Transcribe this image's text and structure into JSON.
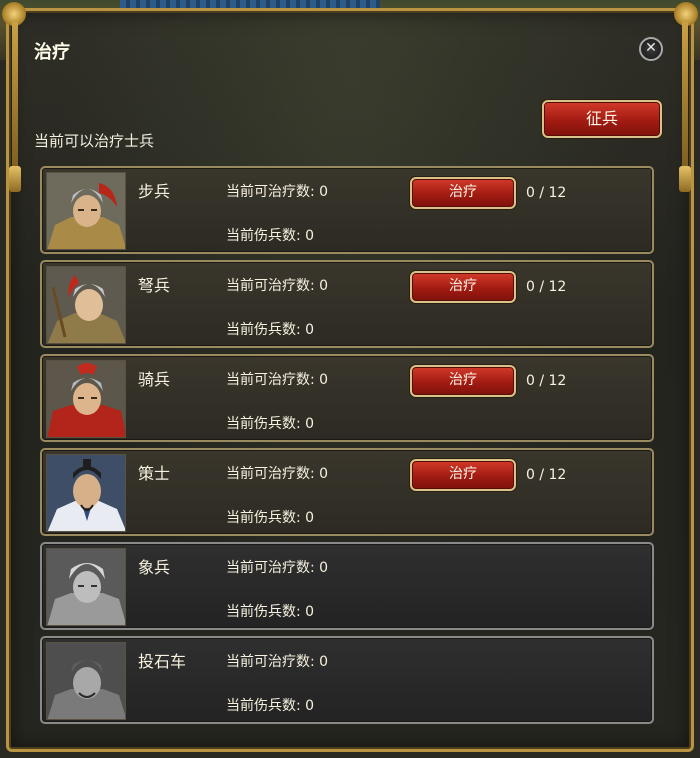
{
  "dialog": {
    "title": "治疗",
    "close_icon": "close-icon",
    "subtitle": "当前可以治疗士兵",
    "recruit_label": "征兵"
  },
  "units": [
    {
      "name": "步兵",
      "heal_text": "当前可治疗数: 0",
      "wounded_text": "当前伤兵数: 0",
      "heal_label": "治疗",
      "progress": "0 / 12",
      "available": true
    },
    {
      "name": "弩兵",
      "heal_text": "当前可治疗数: 0",
      "wounded_text": "当前伤兵数: 0",
      "heal_label": "治疗",
      "progress": "0 / 12",
      "available": true
    },
    {
      "name": "骑兵",
      "heal_text": "当前可治疗数: 0",
      "wounded_text": "当前伤兵数: 0",
      "heal_label": "治疗",
      "progress": "0 / 12",
      "available": true
    },
    {
      "name": "策士",
      "heal_text": "当前可治疗数: 0",
      "wounded_text": "当前伤兵数: 0",
      "heal_label": "治疗",
      "progress": "0 / 12",
      "available": true
    },
    {
      "name": "象兵",
      "heal_text": "当前可治疗数: 0",
      "wounded_text": "当前伤兵数: 0",
      "available": false
    },
    {
      "name": "投石车",
      "heal_text": "当前可治疗数: 0",
      "wounded_text": "当前伤兵数: 0",
      "available": false
    }
  ],
  "colors": {
    "button_red": "#a21b12",
    "frame_gold": "#b99543"
  }
}
